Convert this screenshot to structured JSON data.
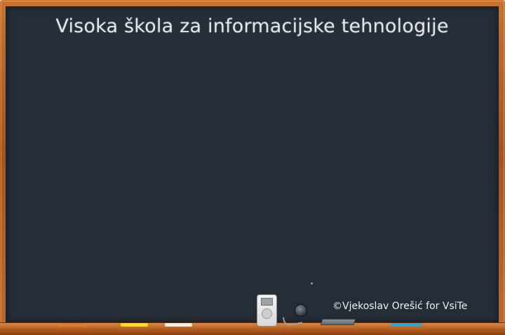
{
  "board": {
    "title": "Visoka škola za informacijske tehnologije",
    "credit": "©Vjekoslav Orešić for VsiTe"
  },
  "chalk_colors": {
    "orange": "#e07a2e",
    "yellow": "#f4e21c",
    "white": "#f2f2f2",
    "blue": "#29a6d8"
  },
  "colors": {
    "board": "#252d36",
    "frame": "#b0591f",
    "text": "#e3e6ea"
  },
  "icons": {
    "music_player": "ipod-icon",
    "earbud": "earbud-icon",
    "eraser": "eraser-icon"
  }
}
